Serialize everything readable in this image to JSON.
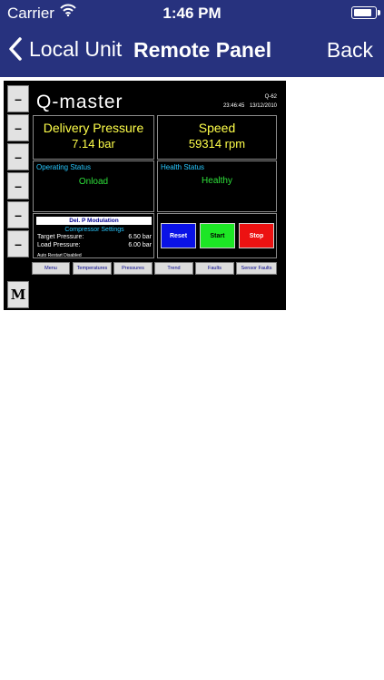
{
  "status_bar": {
    "carrier": "Carrier",
    "time": "1:46 PM",
    "battery_level": 1.0,
    "wifi_icon": "wifi-icon"
  },
  "nav": {
    "local_unit": "Local Unit",
    "title": "Remote Panel",
    "back": "Back"
  },
  "panel": {
    "side_buttons": [
      "–",
      "–",
      "–",
      "–",
      "–",
      "–",
      "M"
    ],
    "logo": "Q-master",
    "unit_id": "Q-62",
    "time": "23:46:45",
    "date": "13/12/2010",
    "delivery_pressure": {
      "label": "Delivery Pressure",
      "value": "7.14 bar"
    },
    "speed": {
      "label": "Speed",
      "value": "59314 rpm"
    },
    "operating_status": {
      "label": "Operating Status",
      "value": "Onload"
    },
    "health_status": {
      "label": "Health Status",
      "value": "Healthy"
    },
    "settings": {
      "modulation": "Del. P Modulation",
      "title": "Compressor Settings",
      "target_label": "Target Pressure:",
      "target_value": "6.50 bar",
      "load_label": "Load Pressure:",
      "load_value": "6.00 bar",
      "auto_restart": "Auto Restart Disabled"
    },
    "controls": {
      "reset": "Reset",
      "start": "Start",
      "stop": "Stop"
    },
    "colors": {
      "reset": "#0a12e6",
      "start": "#1de625",
      "stop": "#ec1212",
      "value_text": "#ffff4a",
      "status_text": "#2ee03a",
      "label_text": "#28c8ff"
    },
    "tabs": [
      "Menu",
      "Temperatures",
      "Pressures",
      "Trend",
      "Faults",
      "Sensor Faults"
    ]
  }
}
